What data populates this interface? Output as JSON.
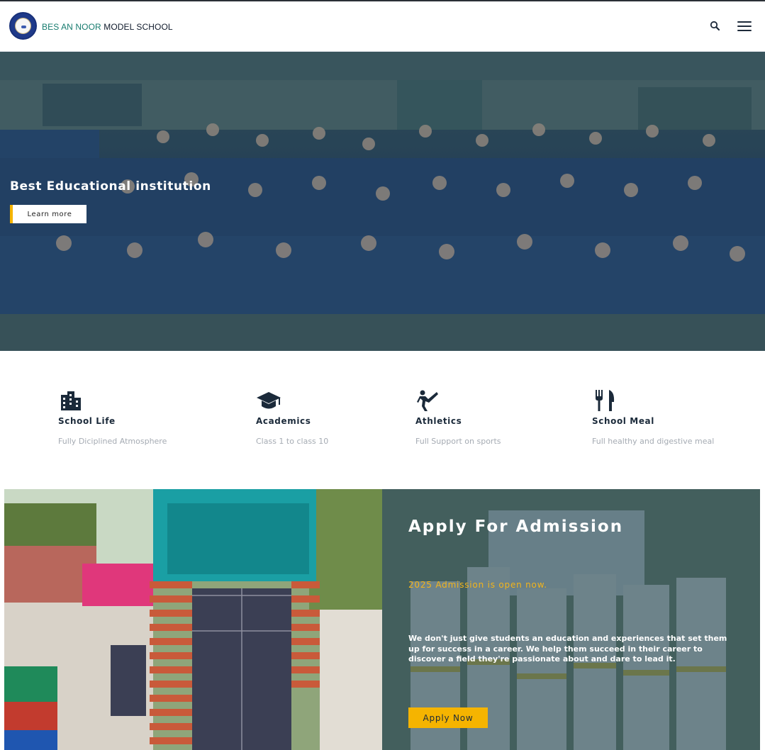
{
  "header": {
    "brand_part1": "BES AN NOOR",
    "brand_part2": "MODEL SCHOOL",
    "search_icon": "search-icon",
    "menu_icon": "hamburger-menu-icon"
  },
  "hero": {
    "title": "Best Educational institution",
    "button_label": "Learn more",
    "accent_color": "#f5b400"
  },
  "features": [
    {
      "icon": "building-icon",
      "title": "School Life",
      "description": "Fully Diciplined Atmosphere"
    },
    {
      "icon": "graduation-cap-icon",
      "title": "Academics",
      "description": "Class 1 to class 10"
    },
    {
      "icon": "martial-arts-icon",
      "title": "Athletics",
      "description": "Full Support on sports"
    },
    {
      "icon": "fork-knife-icon",
      "title": "School Meal",
      "description": "Full healthy and digestive meal"
    }
  ],
  "admission": {
    "title": "Apply For Admission",
    "subtitle": "2025 Admission is open now.",
    "text": "We don't just give students an education and experiences that set them up for success in a career. We help them succeed in their career to discover a field they're passionate about and dare to lead it.",
    "button_label": "Apply Now",
    "accent_color": "#f5b400"
  }
}
